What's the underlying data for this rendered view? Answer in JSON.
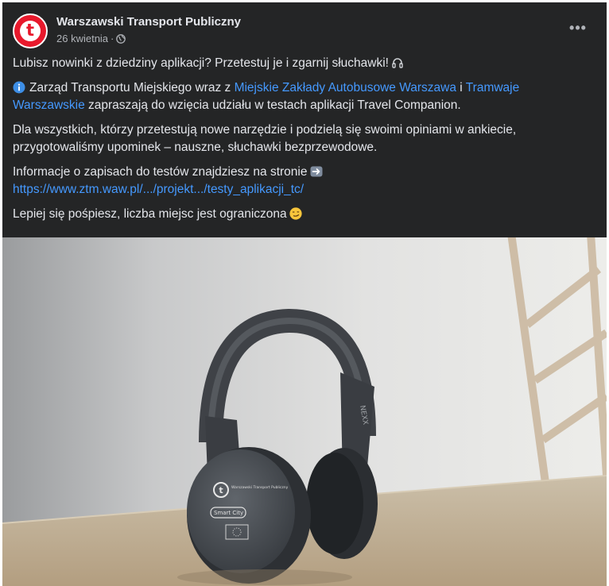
{
  "post": {
    "author": "Warszawski Transport Publiczny",
    "avatar_letter": "t",
    "date": "26 kwietnia",
    "separator": "·",
    "privacy_icon": "globe-icon",
    "more_label": "•••",
    "paragraphs": {
      "p1": {
        "text": "Lubisz nowinki z dziedziny aplikacji? Przetestuj je i zgarnij słuchawki!",
        "emoji": "headphones-icon"
      },
      "p2": {
        "lead_icon": "info-icon",
        "t1": "Zarząd Transportu Miejskiego wraz z ",
        "link1": "Miejskie Zakłady Autobusowe Warszawa",
        "t2": " i ",
        "link2": "Tramwaje Warszawskie",
        "t3": " zapraszają do wzięcia udziału w testach aplikacji Travel Companion."
      },
      "p3": "Dla wszystkich, którzy przetestują nowe narzędzie i podzielą się swoimi opiniami w ankiecie, przygotowaliśmy upominek – nauszne, słuchawki bezprzewodowe.",
      "p4": {
        "text": "Informacje o zapisach do testów znajdziesz na stronie",
        "arrow_icon": "right-arrow-icon",
        "link": "https://www.ztm.waw.pl/.../projekt.../testy_aplikacji_tc/"
      },
      "p5": {
        "text": "Lepiej się pośpiesz, liczba miejsc jest ograniczona",
        "emoji": "smirk-emoji-icon"
      }
    },
    "photo": {
      "subject": "headphones",
      "cup_logo_label": "Warszawski Transport Publiczny",
      "cup_badge_label": "Smart City",
      "side_label": "NEXX"
    },
    "colors": {
      "card_bg": "#242526",
      "text": "#e4e6eb",
      "secondary": "#b0b3b8",
      "link": "#4599ff",
      "brand_red": "#e8192c"
    }
  }
}
